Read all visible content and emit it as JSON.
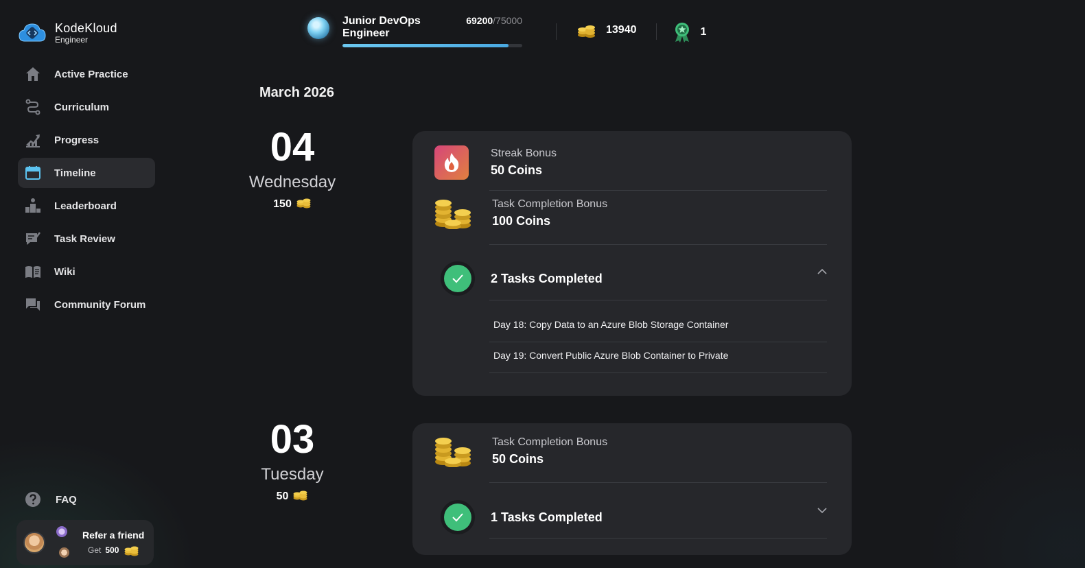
{
  "brand": {
    "name": "KodeKloud",
    "sub": "Engineer"
  },
  "nav": [
    {
      "label": "Active Practice",
      "icon": "home-icon"
    },
    {
      "label": "Curriculum",
      "icon": "route-icon"
    },
    {
      "label": "Progress",
      "icon": "progress-icon"
    },
    {
      "label": "Timeline",
      "icon": "calendar-icon",
      "active": true
    },
    {
      "label": "Leaderboard",
      "icon": "leaderboard-icon"
    },
    {
      "label": "Task Review",
      "icon": "task-review-icon"
    },
    {
      "label": "Wiki",
      "icon": "book-icon"
    },
    {
      "label": "Community Forum",
      "icon": "forum-icon"
    }
  ],
  "faq": {
    "label": "FAQ"
  },
  "refer": {
    "title": "Refer a friend",
    "get_label": "Get",
    "amount": "500"
  },
  "topbar": {
    "rank": "Junior DevOps Engineer",
    "xp_current": "69200",
    "xp_max": "/75000",
    "xp_fraction": 0.923,
    "coins": "13940",
    "badges": "1"
  },
  "timeline": {
    "month": "March 2026",
    "days": [
      {
        "day": "04",
        "weekday": "Wednesday",
        "coins": "150",
        "streak": {
          "label": "Streak Bonus",
          "value": "50 Coins"
        },
        "task_bonus": {
          "label": "Task Completion Bonus",
          "value": "100 Coins"
        },
        "tasks_title": "2 Tasks Completed",
        "expanded": true,
        "tasks": [
          "Day 18: Copy Data to an Azure Blob Storage Container",
          "Day 19: Convert Public Azure Blob Container to Private"
        ]
      },
      {
        "day": "03",
        "weekday": "Tuesday",
        "coins": "50",
        "task_bonus": {
          "label": "Task Completion Bonus",
          "value": "50 Coins"
        },
        "tasks_title": "1 Tasks Completed",
        "expanded": false
      }
    ]
  },
  "colors": {
    "accent": "#4aa9e2",
    "success": "#3fbf7a",
    "card": "#26272b",
    "background": "#17181b"
  }
}
